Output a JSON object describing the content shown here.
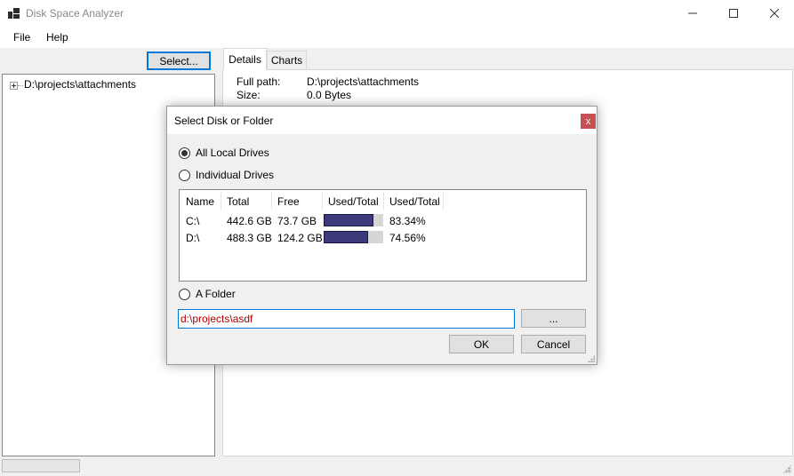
{
  "window": {
    "title": "Disk Space Analyzer"
  },
  "menu": {
    "items": [
      "File",
      "Help"
    ]
  },
  "left": {
    "select_button": "Select...",
    "tree": {
      "root": "D:\\projects\\attachments"
    }
  },
  "tabs": [
    "Details",
    "Charts"
  ],
  "details": {
    "full_path_label": "Full path:",
    "full_path_value": "D:\\projects\\attachments",
    "size_label": "Size:",
    "size_value": "0.0 Bytes"
  },
  "dialog": {
    "title": "Select Disk or Folder",
    "close_label": "x",
    "option_all": "All Local Drives",
    "option_individual": "Individual Drives",
    "option_folder": "A Folder",
    "selected_option": "All Local Drives",
    "columns": [
      "Name",
      "Total",
      "Free",
      "Used/Total",
      "Used/Total"
    ],
    "drives": [
      {
        "name": "C:\\",
        "total": "442.6 GB",
        "free": "73.7 GB",
        "used_fraction": 0.8334,
        "used_pct": "83.34%"
      },
      {
        "name": "D:\\",
        "total": "488.3 GB",
        "free": "124.2 GB",
        "used_fraction": 0.7456,
        "used_pct": "74.56%"
      }
    ],
    "folder_value": "d:\\projects\\asdf",
    "browse_label": "...",
    "ok_label": "OK",
    "cancel_label": "Cancel"
  },
  "colors": {
    "accent": "#0078d7",
    "bar_fill": "#3d3a7c",
    "folder_text": "#b00000",
    "close_button": "#c75050"
  }
}
